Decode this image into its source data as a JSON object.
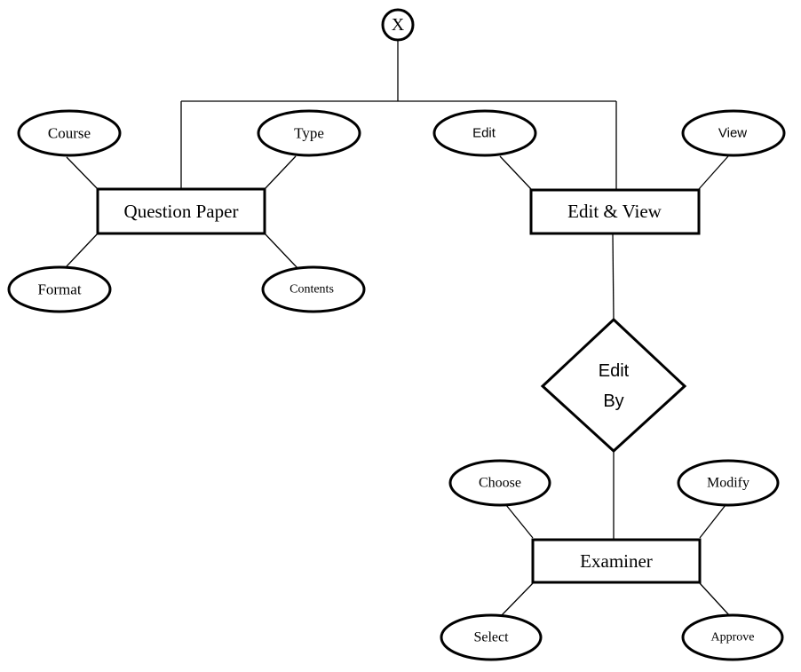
{
  "root": {
    "label": "X"
  },
  "entities": {
    "question_paper": {
      "label": "Question Paper",
      "attributes": [
        "Course",
        "Type",
        "Format",
        "Contents"
      ]
    },
    "edit_view": {
      "label": "Edit & View",
      "attributes": [
        "Edit",
        "View"
      ]
    },
    "examiner": {
      "label": "Examiner",
      "attributes": [
        "Choose",
        "Modify",
        "Select",
        "Approve"
      ]
    }
  },
  "relationship": {
    "line1": "Edit",
    "line2": "By"
  }
}
